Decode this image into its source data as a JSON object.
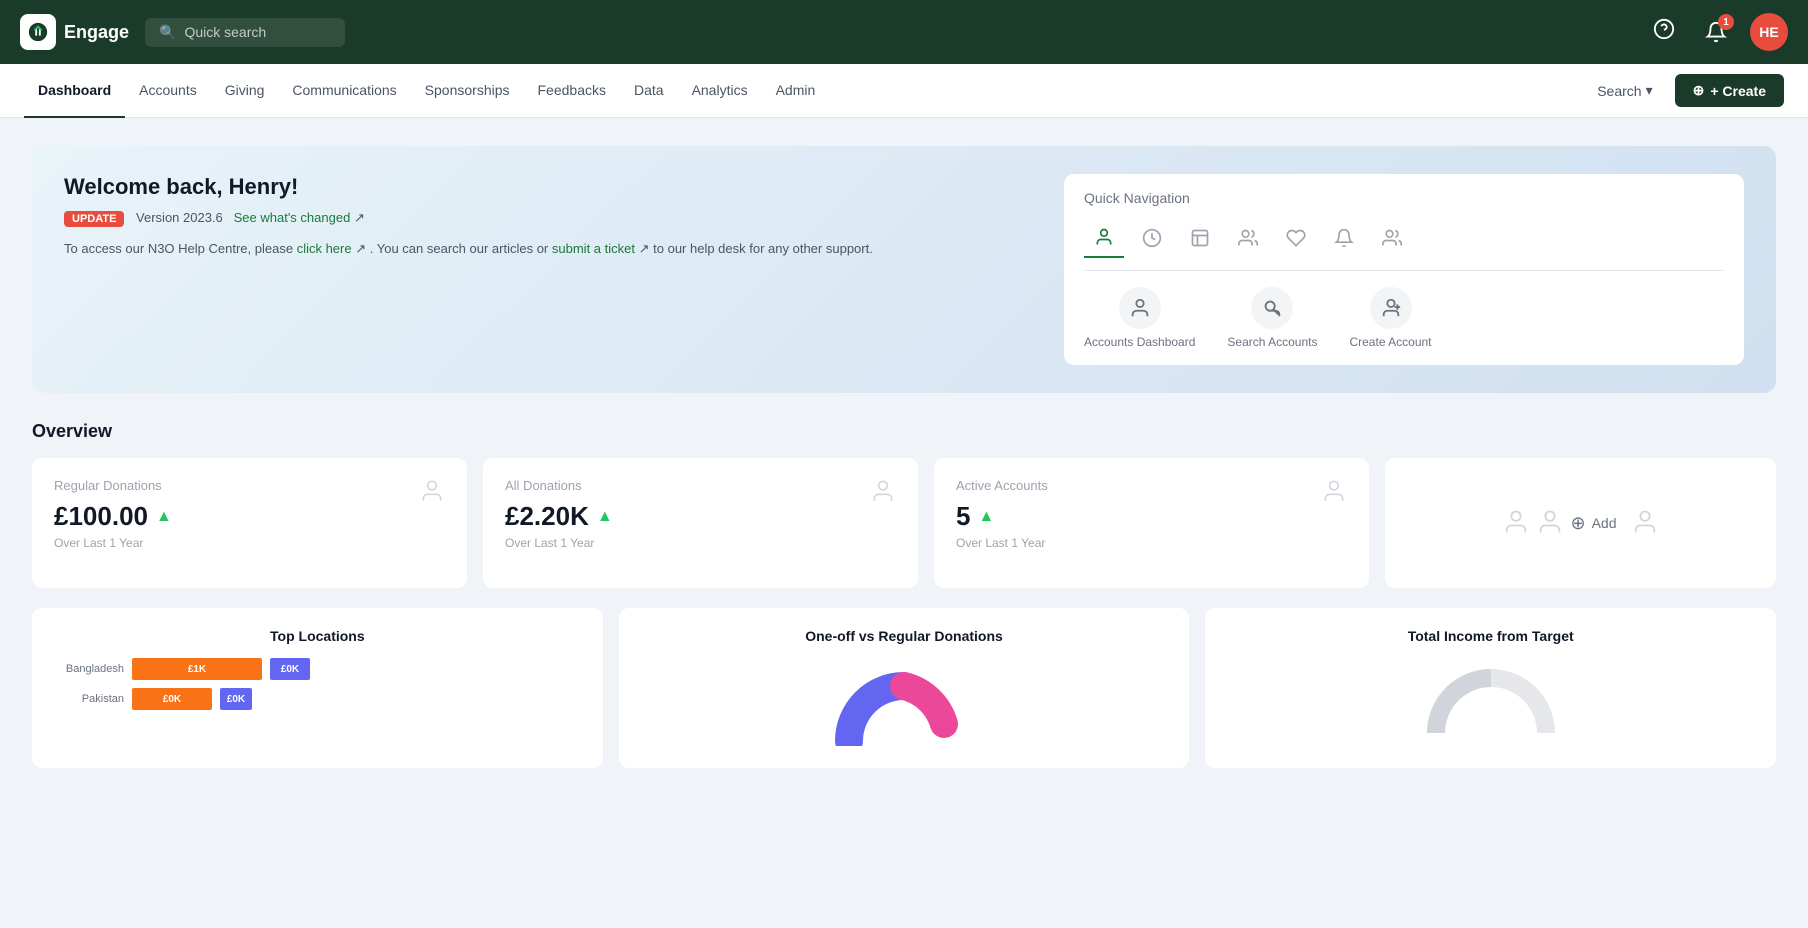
{
  "app": {
    "name": "Engage",
    "search_placeholder": "Quick search"
  },
  "topbar": {
    "help_icon": "?",
    "notification_count": "1",
    "avatar_initials": "HE"
  },
  "subnav": {
    "items": [
      {
        "label": "Dashboard",
        "active": true
      },
      {
        "label": "Accounts",
        "active": false
      },
      {
        "label": "Giving",
        "active": false
      },
      {
        "label": "Communications",
        "active": false
      },
      {
        "label": "Sponsorships",
        "active": false
      },
      {
        "label": "Feedbacks",
        "active": false
      },
      {
        "label": "Data",
        "active": false
      },
      {
        "label": "Analytics",
        "active": false
      },
      {
        "label": "Admin",
        "active": false
      }
    ],
    "search_label": "Search",
    "create_label": "+ Create"
  },
  "welcome": {
    "title": "Welcome back, Henry!",
    "update_badge": "UPDATE",
    "version_text": "Version 2023.6",
    "see_changes": "See what's changed",
    "help_text1": "To access our N3O Help Centre, please",
    "click_here": "click here",
    "help_text2": ". You can search our articles or",
    "submit_ticket": "submit a ticket",
    "help_text3": "to our help desk for any other support."
  },
  "quick_nav": {
    "title": "Quick Navigation",
    "shortcuts": [
      {
        "label": "Accounts Dashboard",
        "icon": "👤"
      },
      {
        "label": "Search Accounts",
        "icon": "🔍"
      },
      {
        "label": "Create Account",
        "icon": "👤+"
      }
    ]
  },
  "overview": {
    "title": "Overview",
    "cards": [
      {
        "label": "Regular Donations",
        "value": "£100.00",
        "trend": "up",
        "sublabel": "Over Last 1 Year"
      },
      {
        "label": "All Donations",
        "value": "£2.20K",
        "trend": "up",
        "sublabel": "Over Last 1 Year"
      },
      {
        "label": "Active Accounts",
        "value": "5",
        "trend": "up",
        "sublabel": "Over Last 1 Year"
      }
    ],
    "add_label": "Add"
  },
  "charts": [
    {
      "title": "Top Locations",
      "type": "bar",
      "rows": [
        {
          "label": "Bangladesh",
          "orange": 130,
          "orange_val": "£1K",
          "purple": 40,
          "purple_val": "£0K"
        },
        {
          "label": "Pakistan",
          "orange": 80,
          "orange_val": "£0K",
          "purple": 30,
          "purple_val": "£0K"
        }
      ]
    },
    {
      "title": "One-off vs Regular Donations",
      "type": "donut"
    },
    {
      "title": "Total Income from Target",
      "type": "gauge"
    }
  ]
}
